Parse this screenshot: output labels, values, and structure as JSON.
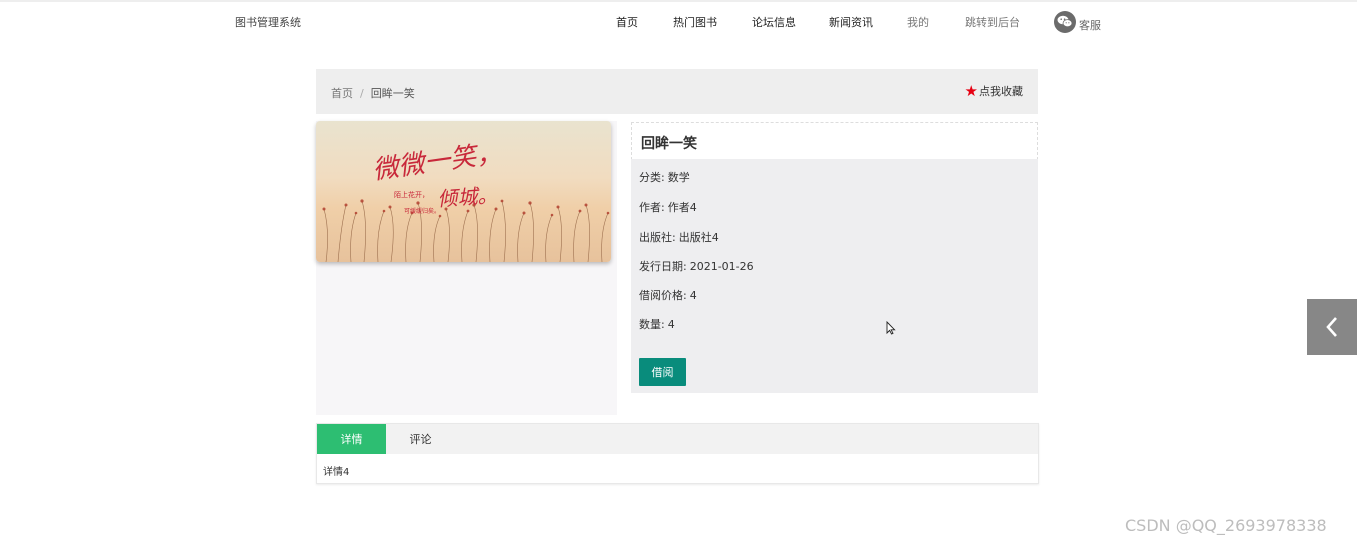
{
  "header": {
    "brand": "图书管理系统",
    "nav": [
      "首页",
      "热门图书",
      "论坛信息",
      "新闻资讯",
      "我的",
      "跳转到后台"
    ],
    "service": "客服"
  },
  "breadcrumb": {
    "home": "首页",
    "separator": "/",
    "current": "回眸一笑"
  },
  "favorite_label": "点我收藏",
  "cover_text": {
    "main": "微微一笑，",
    "second": "倾城。",
    "small1": "陌上花开，",
    "small2": "可缓缓归矣。"
  },
  "book": {
    "title": "回眸一笑",
    "fields": [
      {
        "label": "分类:",
        "value": "数学"
      },
      {
        "label": "作者:",
        "value": "作者4"
      },
      {
        "label": "出版社:",
        "value": "出版社4"
      },
      {
        "label": "发行日期:",
        "value": "2021-01-26"
      },
      {
        "label": "借阅价格:",
        "value": "4"
      },
      {
        "label": "数量:",
        "value": "4"
      }
    ],
    "borrow_label": "借阅"
  },
  "tabs": {
    "details": "详情",
    "comments": "评论",
    "content": "详情4"
  },
  "watermark": "CSDN @QQ_2693978338",
  "colors": {
    "accent_green": "#2dbe72",
    "button_teal": "#098c7c",
    "star_red": "#e60012"
  },
  "icons": {
    "service": "wechat-icon",
    "favorite": "star-icon",
    "side": "chevron-left-icon"
  }
}
